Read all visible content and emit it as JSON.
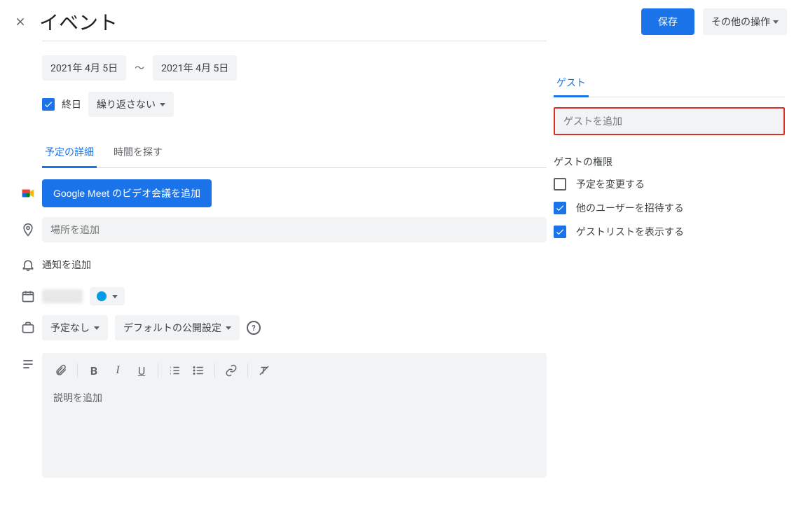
{
  "header": {
    "title": "イベント",
    "save_label": "保存",
    "more_label": "その他の操作"
  },
  "dates": {
    "start": "2021年 4月 5日",
    "end": "2021年 4月 5日",
    "allday_label": "終日",
    "repeat_label": "繰り返さない"
  },
  "tabs": {
    "details": "予定の詳細",
    "findtime": "時間を探す"
  },
  "meet_button": "Google Meet のビデオ会議を追加",
  "location_placeholder": "場所を追加",
  "notification_label": "通知を追加",
  "availability": {
    "status": "予定なし",
    "visibility": "デフォルトの公開設定"
  },
  "description_placeholder": "説明を追加",
  "guests": {
    "tab_label": "ゲスト",
    "input_placeholder": "ゲストを追加",
    "permissions_title": "ゲストの権限",
    "permissions": [
      {
        "label": "予定を変更する",
        "checked": false
      },
      {
        "label": "他のユーザーを招待する",
        "checked": true
      },
      {
        "label": "ゲストリストを表示する",
        "checked": true
      }
    ]
  }
}
